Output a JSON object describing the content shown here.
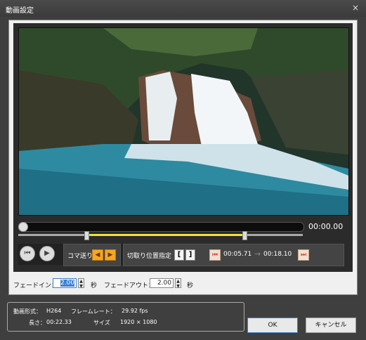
{
  "window": {
    "title": "動画設定",
    "close_label": "×"
  },
  "timeline": {
    "current_time": "00:00.00",
    "position_fraction": 0.0,
    "range_start_fraction": 0.24,
    "range_end_fraction": 0.8
  },
  "controls": {
    "rewind_icon": "⏮",
    "play_icon": "▶",
    "frame_step_label": "コマ送り",
    "frame_prev_icon": "◀",
    "frame_next_icon": "▶",
    "trim_label": "切取り位置指定",
    "trim_start_bracket": "[",
    "trim_end_bracket": "]",
    "jump_start_icon": "⏮",
    "trim_start_time": "00:05.71",
    "trim_arrow": "→",
    "trim_end_time": "00:18.10",
    "jump_end_icon": "⏭"
  },
  "fade": {
    "in_label": "フェードイン：",
    "in_value": "2.00",
    "in_unit": "秒",
    "out_label": "フェードアウト：",
    "out_value": "2.00",
    "out_unit": "秒",
    "spin_up": "▲",
    "spin_down": "▼"
  },
  "info": {
    "format_label": "動画形式：",
    "format_value": "H264",
    "framerate_label": "フレームレート：",
    "framerate_value": "29.92 fps",
    "length_label": "長さ：",
    "length_value": "00:22.33",
    "size_label": "サイズ",
    "size_value": "1920 × 1080"
  },
  "buttons": {
    "ok": "OK",
    "cancel": "キャンセル"
  }
}
